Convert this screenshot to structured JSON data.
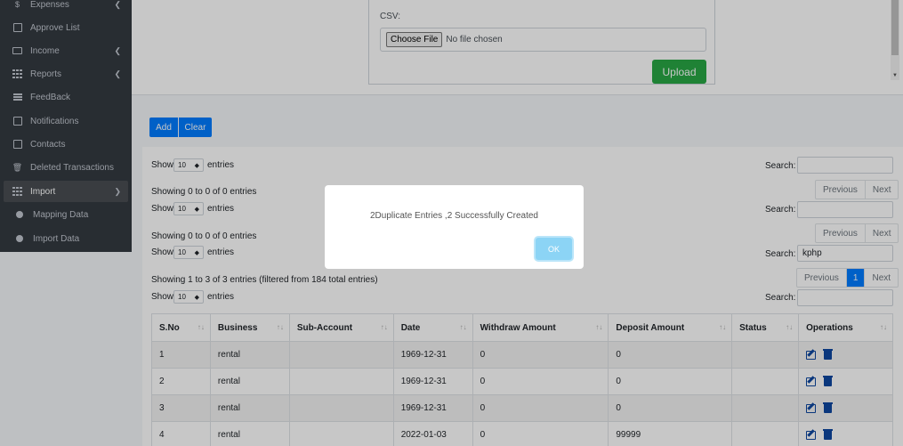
{
  "sidebar": {
    "items": [
      {
        "label": "Expenses",
        "icon": "dollar-icon",
        "has_chevron": true
      },
      {
        "label": "Approve List",
        "icon": "list-icon"
      },
      {
        "label": "Income",
        "icon": "money-icon",
        "has_chevron": true
      },
      {
        "label": "Reports",
        "icon": "grid-icon",
        "has_chevron": true
      },
      {
        "label": "FeedBack",
        "icon": "bars-icon"
      },
      {
        "label": "Notifications",
        "icon": "bell-icon"
      },
      {
        "label": "Contacts",
        "icon": "contact-icon"
      },
      {
        "label": "Deleted Transactions",
        "icon": "trash-icon"
      },
      {
        "label": "Import",
        "icon": "grid-icon",
        "has_chevron": true,
        "active": true
      },
      {
        "label": "Mapping Data",
        "icon": "circle-icon"
      },
      {
        "label": "Import Data",
        "icon": "circle-icon"
      }
    ]
  },
  "upload": {
    "csv_label": "CSV:",
    "choose_file_label": "Choose File",
    "no_file_text": "No file chosen",
    "upload_label": "Upload"
  },
  "actions": {
    "add_label": "Add",
    "clear_label": "Clear"
  },
  "datatables": [
    {
      "show": "Show",
      "page_size": "10",
      "entries": "entries",
      "search_label": "Search:",
      "search_value": "",
      "info": "Showing 0 to 0 of 0 entries",
      "prev": "Previous",
      "next": "Next"
    },
    {
      "show": "Show",
      "page_size": "10",
      "entries": "entries",
      "search_label": "Search:",
      "search_value": "",
      "info": "Showing 0 to 0 of 0 entries",
      "prev": "Previous",
      "next": "Next"
    },
    {
      "show": "Show",
      "page_size": "10",
      "entries": "entries",
      "search_label": "Search:",
      "search_value": "kphp",
      "info": "Showing 1 to 3 of 3 entries (filtered from 184 total entries)",
      "prev": "Previous",
      "current_page": "1",
      "next": "Next"
    },
    {
      "show": "Show",
      "page_size": "10",
      "entries": "entries",
      "search_label": "Search:",
      "search_value": ""
    }
  ],
  "table": {
    "columns": [
      "S.No",
      "Business",
      "Sub-Account",
      "Date",
      "Withdraw Amount",
      "Deposit Amount",
      "Status",
      "Operations"
    ],
    "rows": [
      [
        "1",
        "rental",
        "",
        "1969-12-31",
        "0",
        "0",
        ""
      ],
      [
        "2",
        "rental",
        "",
        "1969-12-31",
        "0",
        "0",
        ""
      ],
      [
        "3",
        "rental",
        "",
        "1969-12-31",
        "0",
        "0",
        ""
      ],
      [
        "4",
        "rental",
        "",
        "2022-01-03",
        "0",
        "99999",
        ""
      ]
    ]
  },
  "modal": {
    "message": "2Duplicate Entries ,2 Successfully Created",
    "ok_label": "OK"
  },
  "colors": {
    "sidebar_bg": "#343a40",
    "primary": "#007bff",
    "success": "#28a745",
    "ok_button": "#8cd4f5"
  }
}
